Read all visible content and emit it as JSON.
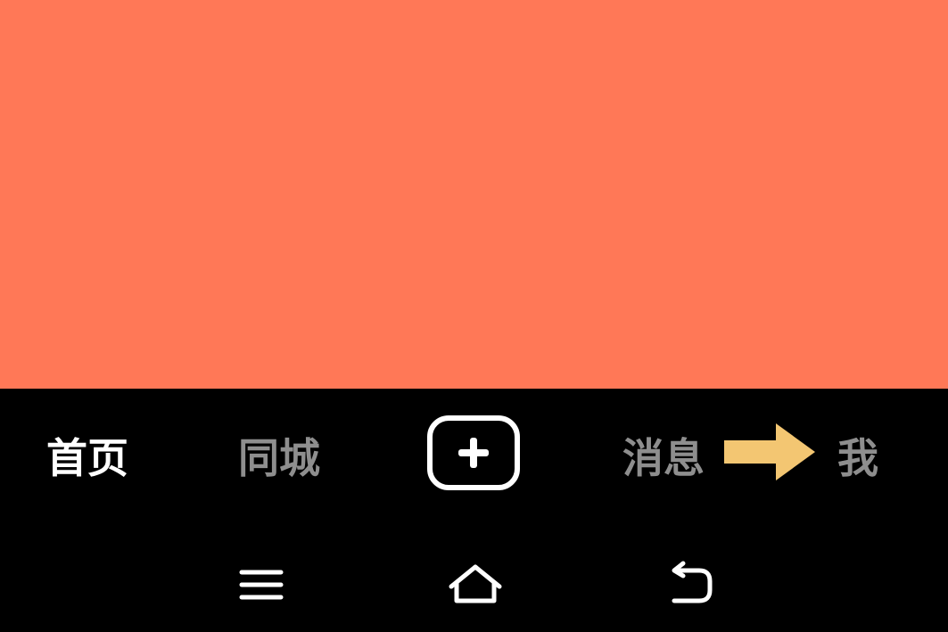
{
  "content": {
    "background_color": "#ff7857"
  },
  "tab_bar": {
    "tabs": [
      {
        "label": "首页",
        "active": true
      },
      {
        "label": "同城",
        "active": false
      },
      {
        "label": "消息",
        "active": false
      },
      {
        "label": "我",
        "active": false
      }
    ],
    "create_icon": "plus-square-icon",
    "annotation_arrow_color": "#f3c672"
  },
  "nav_bar": {
    "icons": [
      "menu-icon",
      "home-icon",
      "back-icon"
    ]
  },
  "colors": {
    "active_tab": "#ffffff",
    "inactive_tab": "#8e8e8e",
    "bar_background": "#000000"
  }
}
